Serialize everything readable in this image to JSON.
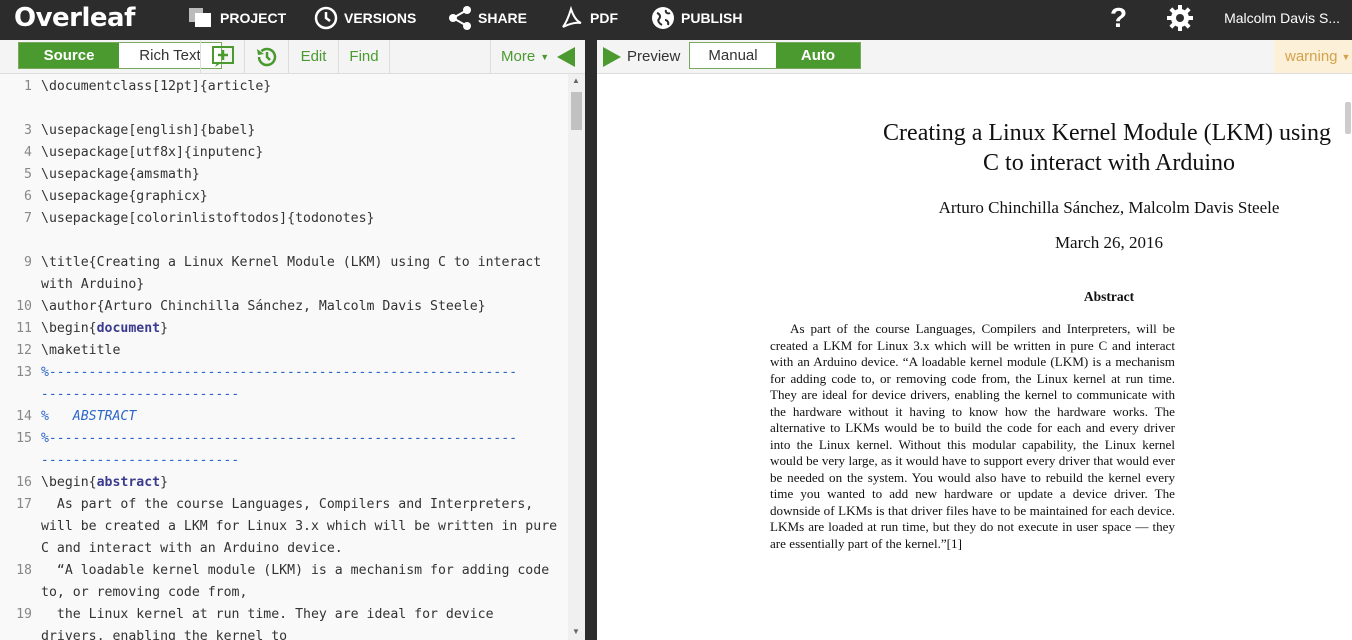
{
  "topbar": {
    "logo": "Overleaf",
    "nav": [
      "PROJECT",
      "VERSIONS",
      "SHARE",
      "PDF",
      "PUBLISH"
    ],
    "help": "?",
    "user": "Malcolm Davis S..."
  },
  "editor_toolbar": {
    "source": "Source",
    "rich_text": "Rich Text",
    "edit": "Edit",
    "find": "Find",
    "more": "More"
  },
  "preview_toolbar": {
    "preview": "Preview",
    "manual": "Manual",
    "auto": "Auto",
    "warning": "warning"
  },
  "editor_lines": [
    {
      "n": "1",
      "t": "\\documentclass[12pt]{article}"
    },
    {
      "n": "",
      "t": ""
    },
    {
      "n": "3",
      "t": "\\usepackage[english]{babel}"
    },
    {
      "n": "4",
      "t": "\\usepackage[utf8x]{inputenc}"
    },
    {
      "n": "5",
      "t": "\\usepackage{amsmath}"
    },
    {
      "n": "6",
      "t": "\\usepackage{graphicx}"
    },
    {
      "n": "7",
      "t": "\\usepackage[colorinlistoftodos]{todonotes}"
    },
    {
      "n": "",
      "t": ""
    },
    {
      "n": "9",
      "t": "\\title{Creating a Linux Kernel Module (LKM) using C to interact"
    },
    {
      "n": "",
      "t": "with Arduino}"
    },
    {
      "n": "10",
      "t": "\\author{Arturo Chinchilla Sánchez, Malcolm Davis Steele}"
    },
    {
      "n": "11",
      "t": "\\begin{document}"
    },
    {
      "n": "12",
      "t": "\\maketitle"
    },
    {
      "n": "13",
      "t": "%-----------------------------------------------------------"
    },
    {
      "n": "",
      "t": "-------------------------"
    },
    {
      "n": "14",
      "t": "%   ABSTRACT"
    },
    {
      "n": "15",
      "t": "%-----------------------------------------------------------"
    },
    {
      "n": "",
      "t": "-------------------------"
    },
    {
      "n": "16",
      "t": "\\begin{abstract}"
    },
    {
      "n": "17",
      "t": "  As part of the course Languages, Compilers and Interpreters,"
    },
    {
      "n": "",
      "t": "will be created a LKM for Linux 3.x which will be written in pure"
    },
    {
      "n": "",
      "t": "C and interact with an Arduino device."
    },
    {
      "n": "18",
      "t": "  “A loadable kernel module (LKM) is a mechanism for adding code"
    },
    {
      "n": "",
      "t": "to, or removing code from,"
    },
    {
      "n": "19",
      "t": "  the Linux kernel at run time. They are ideal for device"
    },
    {
      "n": "",
      "t": "drivers, enabling the kernel to"
    }
  ],
  "pdf": {
    "title_line1": "Creating a Linux Kernel Module (LKM) using",
    "title_line2": "C to interact with Arduino",
    "authors": "Arturo Chinchilla Sánchez, Malcolm Davis Steele",
    "date": "March 26, 2016",
    "abstract_heading": "Abstract",
    "abstract_text": "As part of the course Languages, Compilers and Interpreters, will be created a LKM for Linux 3.x which will be written in pure C and interact with an Arduino device.  “A loadable kernel module (LKM) is a mechanism for adding code to, or removing code from, the Linux kernel at run time.  They are ideal for device drivers, enabling the kernel to communicate with the hardware without it having to know how the hardware works. The alternative to LKMs would be to build the code for each and every driver into the Linux kernel. Without this modular capability, the Linux kernel would be very large, as it would have to support every driver that would ever be needed on the system. You would also have to rebuild the kernel every time you wanted to add new hardware or update a device driver.  The downside of LKMs is that driver files have to be maintained for each device.  LKMs are loaded at run time, but they do not execute in user space — they are essentially part of the kernel.”[1]"
  },
  "colors": {
    "accent": "#4a9a2f",
    "topbar": "#2c2c2c",
    "comment": "#2d66c9"
  }
}
